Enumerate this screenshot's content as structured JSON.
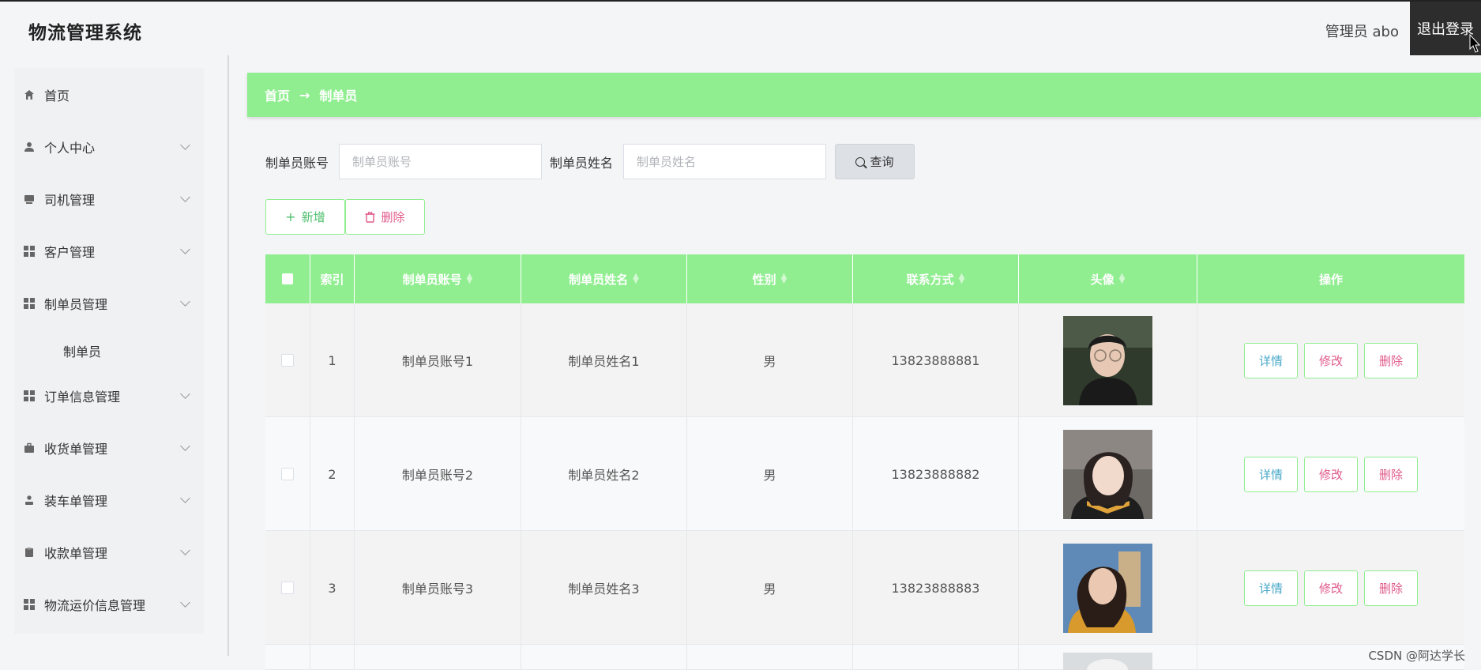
{
  "header": {
    "app_title": "物流管理系统",
    "user_info": "管理员 abo",
    "logout_label": "退出登录"
  },
  "sidebar": {
    "items": [
      {
        "label": "首页",
        "icon": "home-icon"
      },
      {
        "label": "个人中心",
        "icon": "user-icon"
      },
      {
        "label": "司机管理",
        "icon": "driver-icon"
      },
      {
        "label": "客户管理",
        "icon": "grid-icon"
      },
      {
        "label": "制单员管理",
        "icon": "grid-icon"
      },
      {
        "label": "订单信息管理",
        "icon": "grid-icon"
      },
      {
        "label": "收货单管理",
        "icon": "briefcase-icon"
      },
      {
        "label": "装车单管理",
        "icon": "person-icon"
      },
      {
        "label": "收款单管理",
        "icon": "clipboard-icon"
      },
      {
        "label": "物流运价信息管理",
        "icon": "grid-icon"
      }
    ],
    "active_submenu": "制单员"
  },
  "breadcrumb": {
    "home": "首页",
    "arrow": "→",
    "current": "制单员"
  },
  "search": {
    "account_label": "制单员账号",
    "account_placeholder": "制单员账号",
    "name_label": "制单员姓名",
    "name_placeholder": "制单员姓名",
    "query_label": "查询"
  },
  "actions": {
    "add_label": "新增",
    "delete_label": "删除"
  },
  "table": {
    "headers": {
      "index": "索引",
      "account": "制单员账号",
      "name": "制单员姓名",
      "gender": "性别",
      "contact": "联系方式",
      "avatar": "头像",
      "ops": "操作"
    },
    "rows": [
      {
        "index": "1",
        "account": "制单员账号1",
        "name": "制单员姓名1",
        "gender": "男",
        "contact": "13823888881"
      },
      {
        "index": "2",
        "account": "制单员账号2",
        "name": "制单员姓名2",
        "gender": "男",
        "contact": "13823888882"
      },
      {
        "index": "3",
        "account": "制单员账号3",
        "name": "制单员姓名3",
        "gender": "男",
        "contact": "13823888883"
      }
    ],
    "op_labels": {
      "detail": "详情",
      "edit": "修改",
      "delete": "删除"
    }
  },
  "colors": {
    "accent": "#90ee90",
    "header_dark": "#2d2d2d",
    "detail_text": "#4aa8c9",
    "danger_text": "#e05a8a"
  },
  "watermark": "CSDN @阿达学长"
}
